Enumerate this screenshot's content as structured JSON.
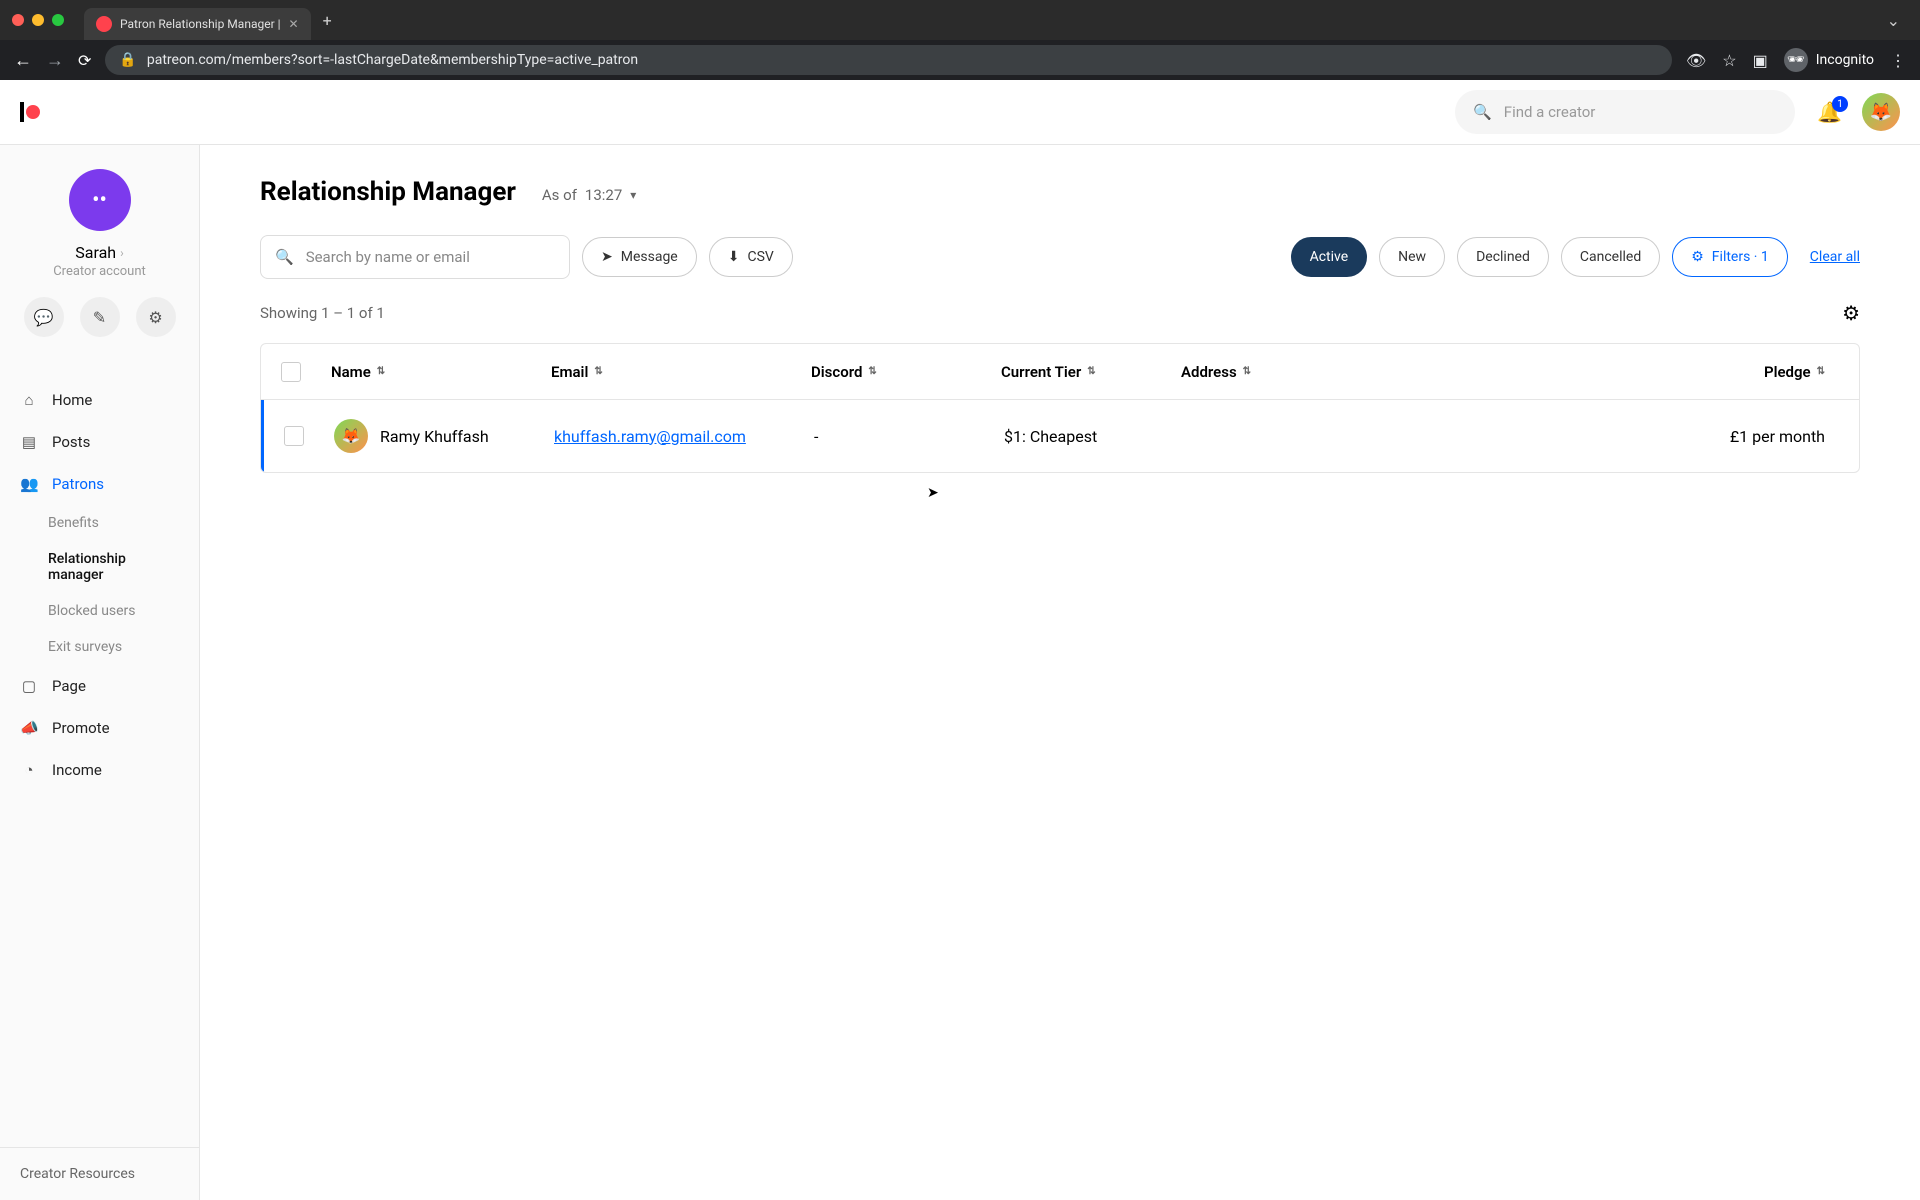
{
  "browser": {
    "tab_title": "Patron Relationship Manager |",
    "url": "patreon.com/members?sort=-lastChargeDate&membershipType=active_patron",
    "incognito_label": "Incognito"
  },
  "header": {
    "search_placeholder": "Find a creator",
    "notif_count": "1"
  },
  "sidebar": {
    "creator_name": "Sarah",
    "creator_role": "Creator account",
    "nav": {
      "home": "Home",
      "posts": "Posts",
      "patrons": "Patrons",
      "benefits": "Benefits",
      "relationship_manager": "Relationship manager",
      "blocked_users": "Blocked users",
      "exit_surveys": "Exit surveys",
      "page": "Page",
      "promote": "Promote",
      "income": "Income"
    },
    "footer": "Creator Resources"
  },
  "main": {
    "title": "Relationship Manager",
    "as_of_prefix": "As of",
    "as_of_time": "13:27",
    "search_placeholder": "Search by name or email",
    "message_btn": "Message",
    "csv_btn": "CSV",
    "filters": {
      "active": "Active",
      "new": "New",
      "declined": "Declined",
      "cancelled": "Cancelled",
      "filters_label": "Filters · 1"
    },
    "clear_all": "Clear all",
    "showing": "Showing 1 – 1 of 1",
    "columns": {
      "name": "Name",
      "email": "Email",
      "discord": "Discord",
      "current_tier": "Current Tier",
      "address": "Address",
      "pledge": "Pledge"
    },
    "rows": [
      {
        "name": "Ramy Khuffash",
        "email": "khuffash.ramy@gmail.com",
        "discord": "-",
        "tier": "$1: Cheapest",
        "address": "",
        "pledge": "£1 per month"
      }
    ]
  }
}
